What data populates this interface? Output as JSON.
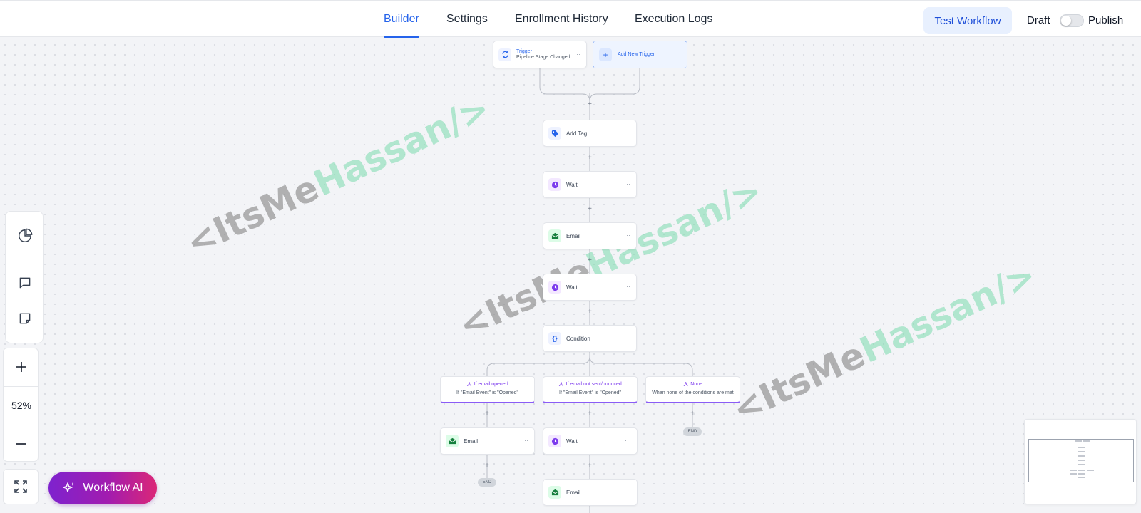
{
  "header": {
    "tabs": [
      {
        "label": "Builder",
        "active": true
      },
      {
        "label": "Settings"
      },
      {
        "label": "Enrollment History"
      },
      {
        "label": "Execution Logs"
      }
    ],
    "test_button": "Test Workflow",
    "draft_label": "Draft",
    "publish_label": "Publish"
  },
  "workflow": {
    "trigger": {
      "title": "Trigger",
      "subtitle": "Pipeline Stage Changed"
    },
    "add_trigger": "Add New Trigger",
    "steps": [
      "Add Tag",
      "Wait",
      "Email",
      "Wait",
      "Condition"
    ],
    "branches": [
      {
        "title": "If email opened",
        "subtitle": "If \"Email Event\" is \"Opened\""
      },
      {
        "title": "If email not sent/bounced",
        "subtitle": "If \"Email Event\" is \"Opened\""
      },
      {
        "title": "None",
        "subtitle": "When none of the conditions are met"
      }
    ],
    "branch_steps": {
      "left": "Email",
      "middle_1": "Wait",
      "middle_2": "Email"
    },
    "end_label": "END",
    "menu_glyph": "···",
    "plus_glyph": "+"
  },
  "zoom": {
    "level": "52%"
  },
  "ai_button": "Workflow AI",
  "watermark": {
    "part1": "<ItsMe",
    "part2": "Hassan/>"
  },
  "colors": {
    "accent": "#2563eb",
    "tag_icon": "#2563eb",
    "wait_icon": "#7c3aed",
    "email_icon": "#15803d",
    "branch_accent": "#8b5cf6"
  }
}
